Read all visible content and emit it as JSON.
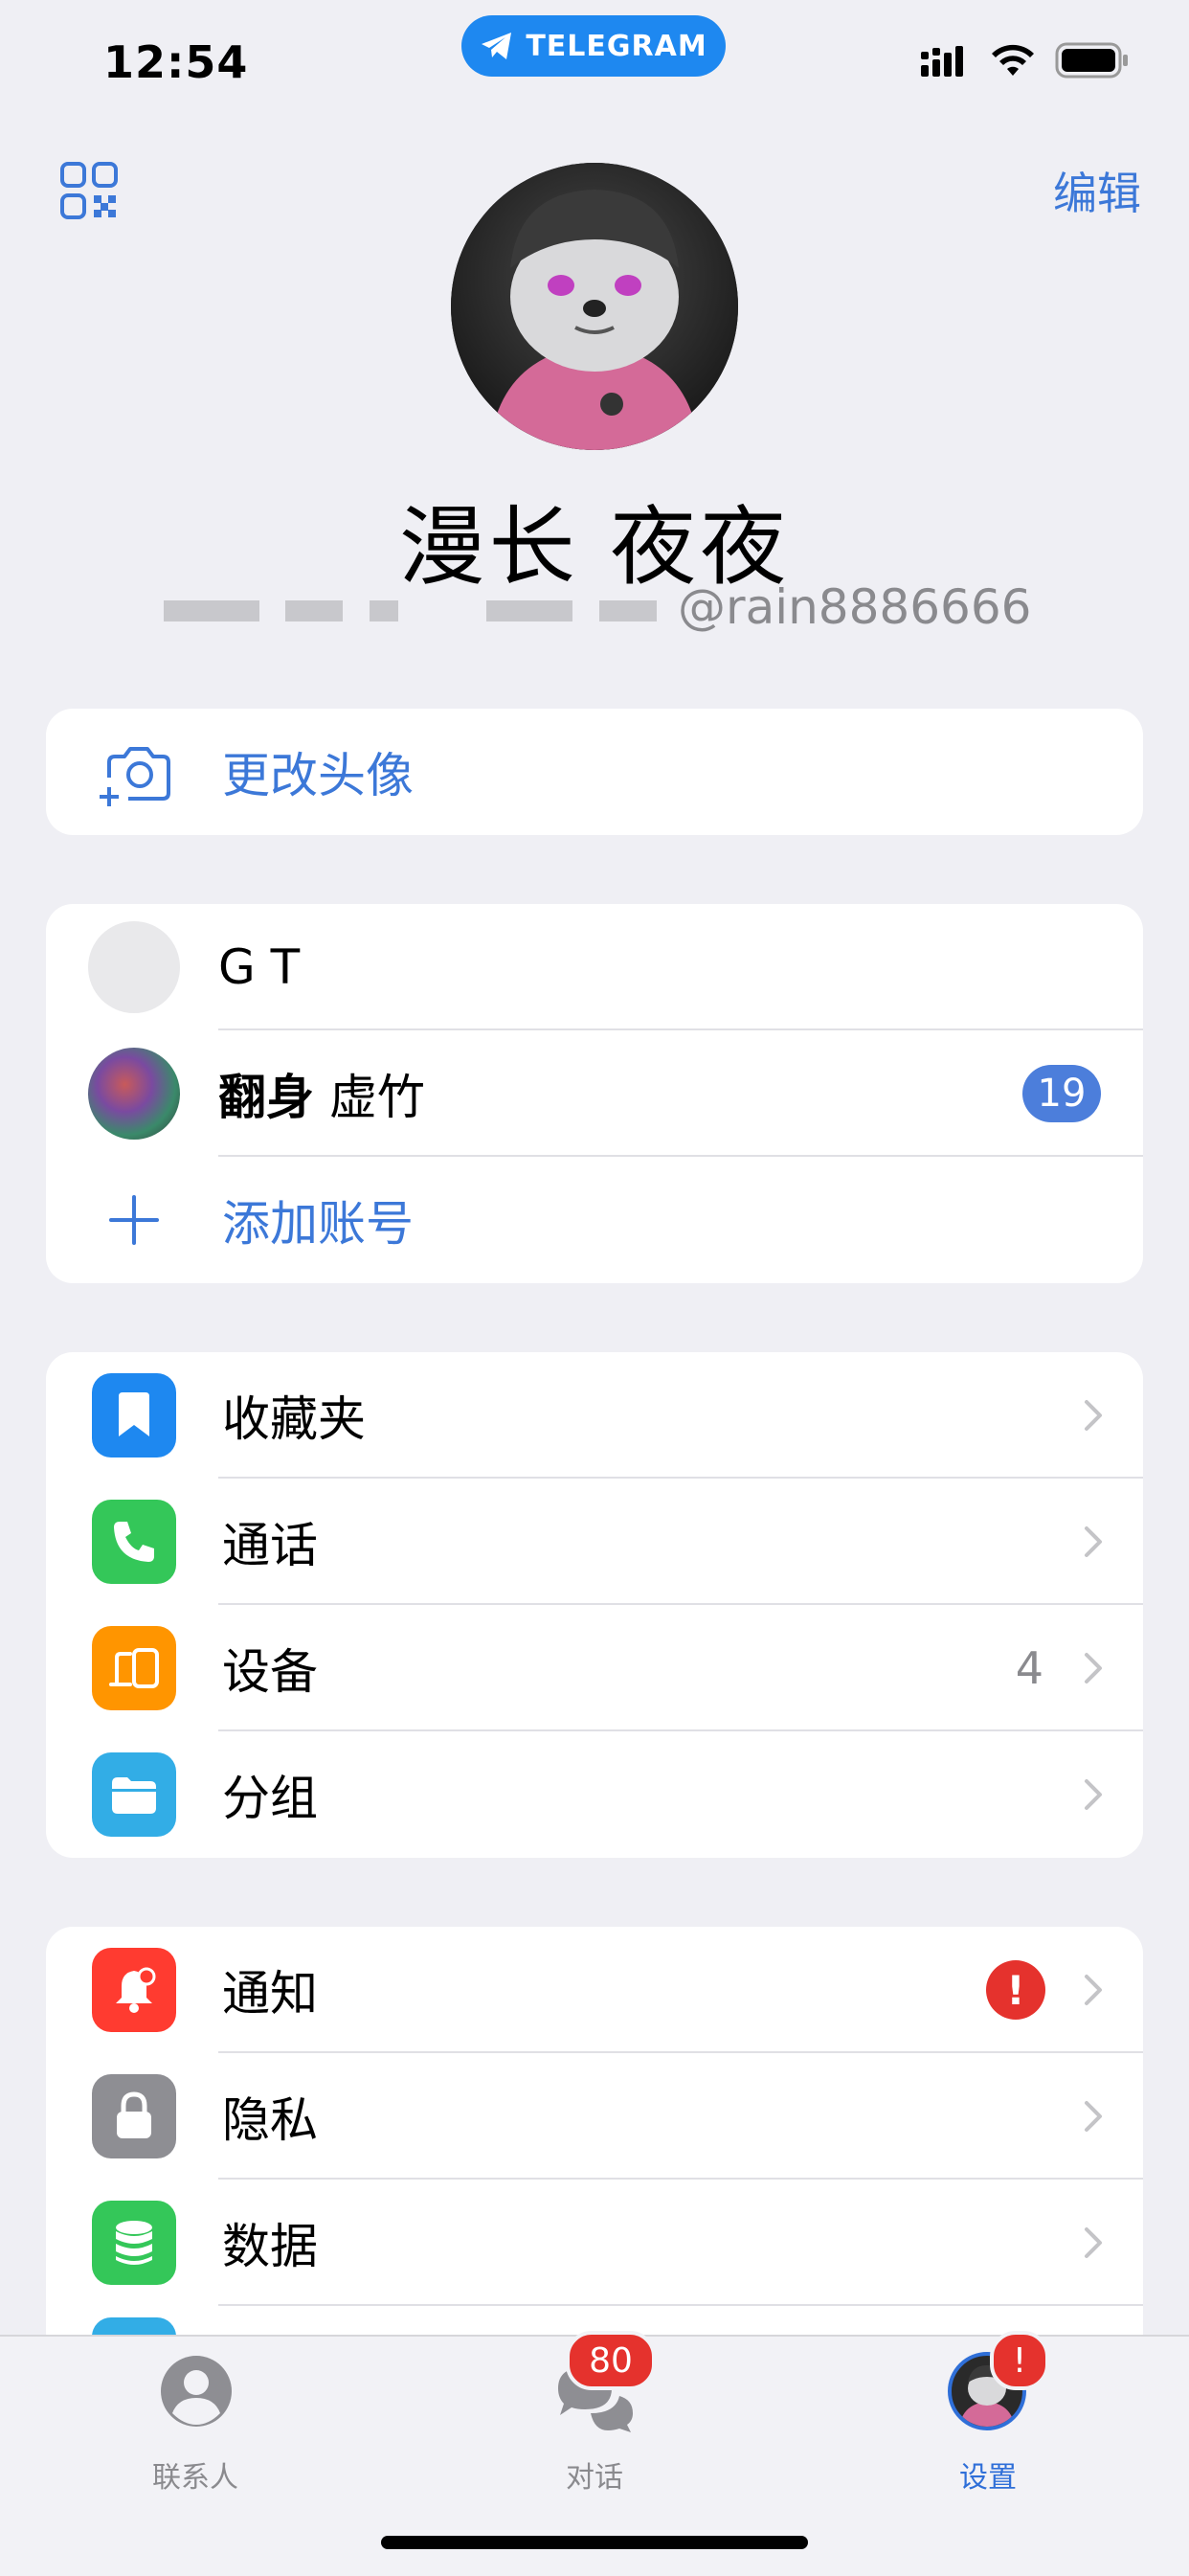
{
  "status_bar": {
    "time": "12:54",
    "app_pill": "TELEGRAM"
  },
  "header": {
    "edit_label": "编辑",
    "profile_name": "漫长 夜夜",
    "username": "@rain8886666"
  },
  "change_photo": {
    "label": "更改头像"
  },
  "accounts": {
    "items": [
      {
        "name": "G T",
        "badge": ""
      },
      {
        "name_bold": "翻身",
        "name_rest": " 虚竹",
        "badge": "19"
      }
    ],
    "add_label": "添加账号"
  },
  "menu_group_1": [
    {
      "label": "收藏夹",
      "icon": "bookmark-icon",
      "color": "#1E88F0",
      "value": ""
    },
    {
      "label": "通话",
      "icon": "phone-icon",
      "color": "#34C759",
      "value": ""
    },
    {
      "label": "设备",
      "icon": "devices-icon",
      "color": "#FF9500",
      "value": "4"
    },
    {
      "label": "分组",
      "icon": "folder-icon",
      "color": "#32ADE6",
      "value": ""
    }
  ],
  "menu_group_2": [
    {
      "label": "通知",
      "icon": "bell-icon",
      "color": "#FF3B30",
      "alert": "!"
    },
    {
      "label": "隐私",
      "icon": "lock-icon",
      "color": "#8E8E93"
    },
    {
      "label": "数据",
      "icon": "database-icon",
      "color": "#34C759"
    }
  ],
  "tabbar": {
    "tabs": [
      {
        "label": "联系人",
        "badge": ""
      },
      {
        "label": "对话",
        "badge": "80"
      },
      {
        "label": "设置",
        "badge": "!"
      }
    ]
  }
}
